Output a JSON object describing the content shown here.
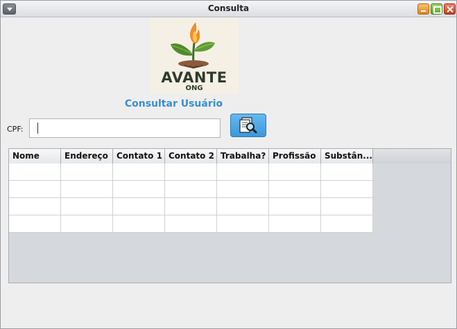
{
  "window": {
    "title": "Consulta"
  },
  "logo": {
    "name": "AVANTE",
    "sub": "ONG"
  },
  "heading": "Consultar Usuário",
  "search": {
    "label": "CPF:",
    "value": "",
    "placeholder": ""
  },
  "table": {
    "columns": [
      "Nome",
      "Endereço",
      "Contato 1",
      "Contato 2",
      "Trabalha?",
      "Profissão",
      "Substân..."
    ],
    "rows": [
      [
        "",
        "",
        "",
        "",
        "",
        "",
        ""
      ],
      [
        "",
        "",
        "",
        "",
        "",
        "",
        ""
      ],
      [
        "",
        "",
        "",
        "",
        "",
        "",
        ""
      ],
      [
        "",
        "",
        "",
        "",
        "",
        "",
        ""
      ]
    ]
  },
  "colors": {
    "accent": "#3a8fd0",
    "button": "#4aa6e6"
  },
  "icons": {
    "search_button": "document-search-icon"
  }
}
